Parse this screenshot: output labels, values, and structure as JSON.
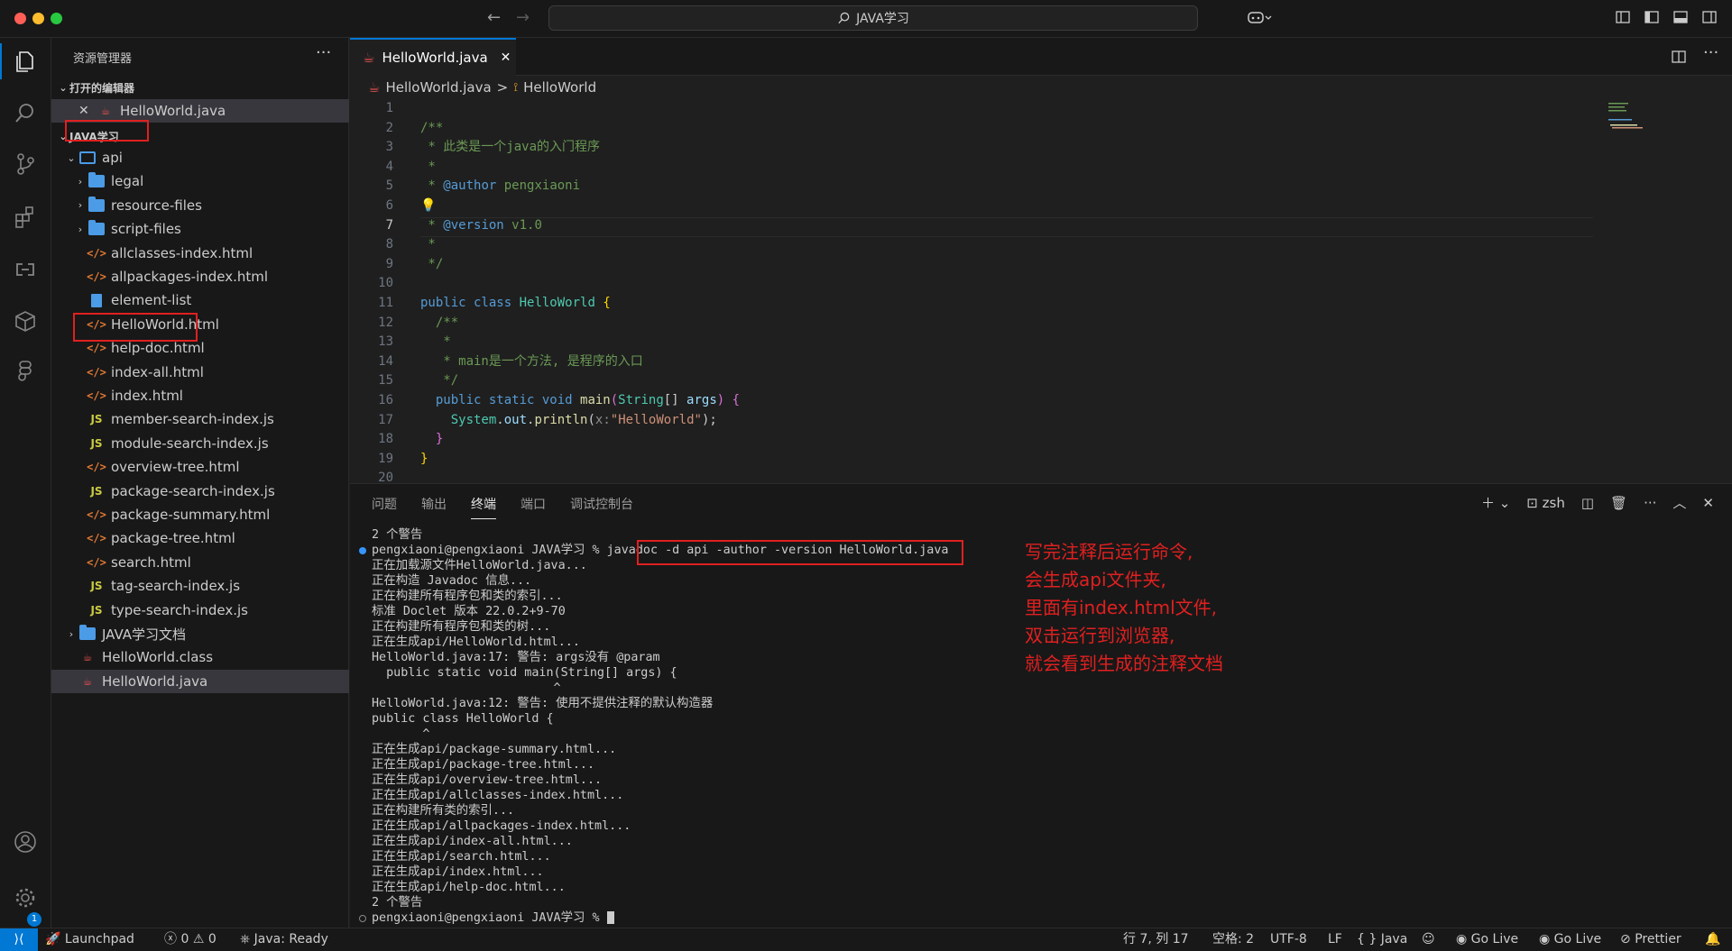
{
  "titlebar": {
    "search_label": "JAVA学习"
  },
  "sidebar": {
    "title": "资源管理器",
    "open_editors": {
      "header": "打开的编辑器",
      "items": [
        {
          "label": "HelloWorld.java"
        }
      ]
    },
    "workspace": {
      "header": "JAVA学习",
      "tree": [
        {
          "label": "api",
          "type": "folder-open",
          "depth": 1
        },
        {
          "label": "legal",
          "type": "folder",
          "depth": 2
        },
        {
          "label": "resource-files",
          "type": "folder",
          "depth": 2
        },
        {
          "label": "script-files",
          "type": "folder",
          "depth": 2
        },
        {
          "label": "allclasses-index.html",
          "type": "html",
          "depth": 2
        },
        {
          "label": "allpackages-index.html",
          "type": "html",
          "depth": 2
        },
        {
          "label": "element-list",
          "type": "doc",
          "depth": 2
        },
        {
          "label": "HelloWorld.html",
          "type": "html",
          "depth": 2
        },
        {
          "label": "help-doc.html",
          "type": "html",
          "depth": 2
        },
        {
          "label": "index-all.html",
          "type": "html",
          "depth": 2
        },
        {
          "label": "index.html",
          "type": "html",
          "depth": 2
        },
        {
          "label": "member-search-index.js",
          "type": "js",
          "depth": 2
        },
        {
          "label": "module-search-index.js",
          "type": "js",
          "depth": 2
        },
        {
          "label": "overview-tree.html",
          "type": "html",
          "depth": 2
        },
        {
          "label": "package-search-index.js",
          "type": "js",
          "depth": 2
        },
        {
          "label": "package-summary.html",
          "type": "html",
          "depth": 2
        },
        {
          "label": "package-tree.html",
          "type": "html",
          "depth": 2
        },
        {
          "label": "search.html",
          "type": "html",
          "depth": 2
        },
        {
          "label": "tag-search-index.js",
          "type": "js",
          "depth": 2
        },
        {
          "label": "type-search-index.js",
          "type": "js",
          "depth": 2
        },
        {
          "label": "JAVA学习文档",
          "type": "folder",
          "depth": 1
        },
        {
          "label": "HelloWorld.class",
          "type": "java",
          "depth": 1
        },
        {
          "label": "HelloWorld.java",
          "type": "java",
          "depth": 1
        }
      ]
    }
  },
  "editor": {
    "tab_label": "HelloWorld.java",
    "breadcrumb": {
      "file": "HelloWorld.java",
      "sep": ">",
      "symbol": "HelloWorld"
    },
    "current_line": 7
  },
  "panel": {
    "tabs": [
      "问题",
      "输出",
      "终端",
      "端口",
      "调试控制台"
    ],
    "active_tab": "终端",
    "shell": "zsh",
    "terminal_lines": [
      "2 个警告",
      "pengxiaoni@pengxiaoni JAVA学习 % javadoc -d api -author -version HelloWorld.java",
      "正在加载源文件HelloWorld.java...",
      "正在构造 Javadoc 信息...",
      "正在构建所有程序包和类的索引...",
      "标准 Doclet 版本 22.0.2+9-70",
      "正在构建所有程序包和类的树...",
      "正在生成api/HelloWorld.html...",
      "HelloWorld.java:17: 警告: args没有 @param",
      "  public static void main(String[] args) {",
      "                         ^",
      "HelloWorld.java:12: 警告: 使用不提供注释的默认构造器",
      "public class HelloWorld {",
      "       ^",
      "正在生成api/package-summary.html...",
      "正在生成api/package-tree.html...",
      "正在生成api/overview-tree.html...",
      "正在生成api/allclasses-index.html...",
      "正在构建所有类的索引...",
      "正在生成api/allpackages-index.html...",
      "正在生成api/index-all.html...",
      "正在生成api/search.html...",
      "正在生成api/index.html...",
      "正在生成api/help-doc.html...",
      "2 个警告",
      "pengxiaoni@pengxiaoni JAVA学习 % "
    ],
    "annotation": [
      "写完注释后运行命令,",
      "会生成api文件夹,",
      "里面有index.html文件,",
      "双击运行到浏览器,",
      "就会看到生成的注释文档"
    ]
  },
  "statusbar": {
    "launchpad": "Launchpad",
    "errors": "0",
    "warnings": "0",
    "java": "Java: Ready",
    "position": "行 7, 列 17",
    "spaces": "空格: 2",
    "encoding": "UTF-8",
    "eol": "LF",
    "language": "Java",
    "golive1": "Go Live",
    "golive2": "Go Live",
    "prettier": "Prettier"
  },
  "activity": {
    "badge": "1"
  },
  "colors": {
    "accent": "#0078d4",
    "annotation_red": "#e02020"
  }
}
